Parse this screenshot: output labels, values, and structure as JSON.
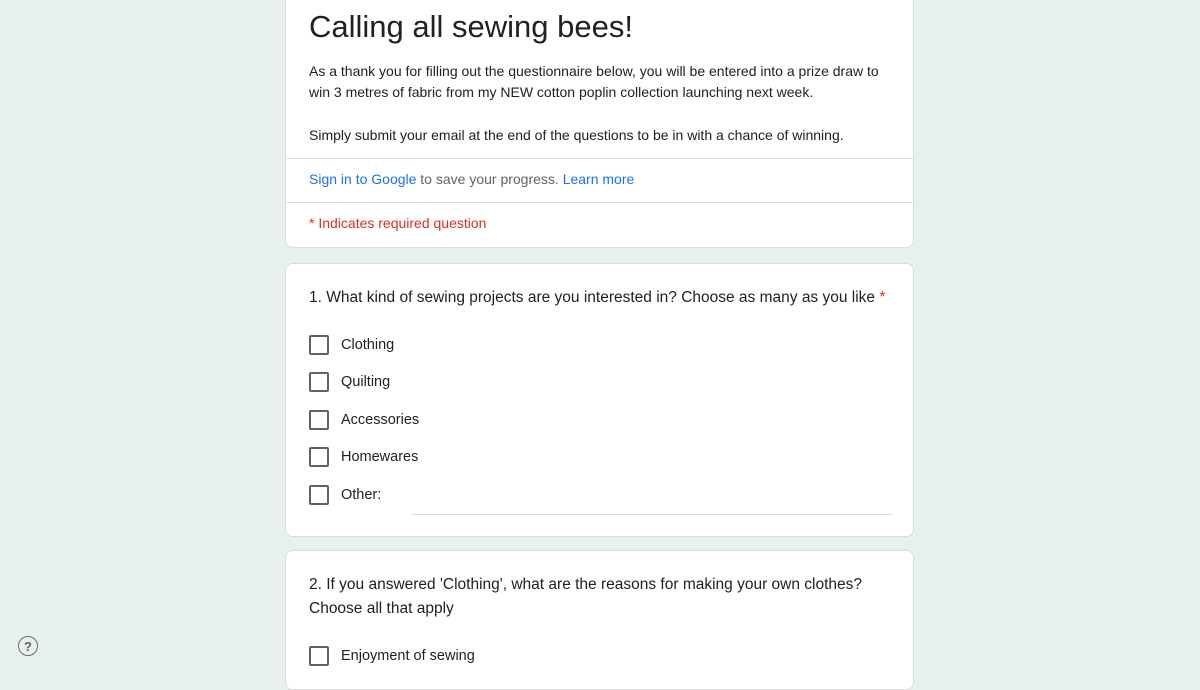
{
  "form": {
    "title": "Calling all sewing bees!",
    "description_1": "As a thank you for filling out the questionnaire below, you will be entered into a prize draw to win 3 metres of fabric from my NEW cotton poplin collection launching next week.",
    "description_2": "Simply submit your email at the end of the questions to be in with a chance of winning.",
    "signin_link": "Sign in to Google",
    "signin_text": " to save your progress. ",
    "learn_more": "Learn more",
    "required_note": "* Indicates required question"
  },
  "questions": [
    {
      "title": "1. What kind of sewing projects are you interested in? Choose as many as you like",
      "required_mark": "*",
      "options": [
        "Clothing",
        "Quilting",
        "Accessories",
        "Homewares",
        "Other:"
      ]
    },
    {
      "title": "2. If you answered 'Clothing', what are the reasons for making your own clothes? Choose all that apply",
      "options": [
        "Enjoyment of sewing"
      ]
    }
  ],
  "help": {
    "icon": "help-circle-icon",
    "glyph": "?"
  },
  "colors": {
    "background": "#e8f0ef",
    "link": "#1a73e8",
    "required": "#d93025"
  }
}
